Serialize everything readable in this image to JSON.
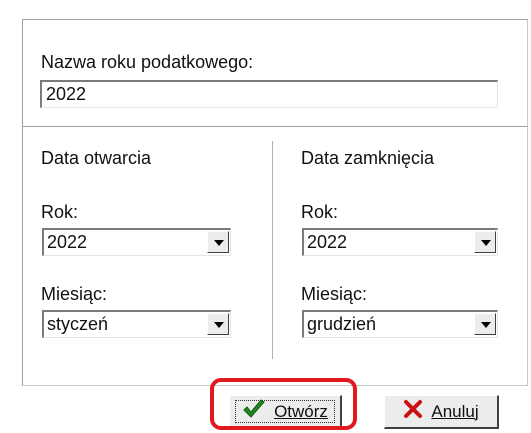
{
  "tax_year": {
    "name_label": "Nazwa roku podatkowego:",
    "name_value": "2022"
  },
  "opening": {
    "title": "Data otwarcia",
    "year_label": "Rok:",
    "year_value": "2022",
    "month_label": "Miesiąc:",
    "month_value": "styczeń"
  },
  "closing": {
    "title": "Data zamknięcia",
    "year_label": "Rok:",
    "year_value": "2022",
    "month_label": "Miesiąc:",
    "month_value": "grudzień"
  },
  "buttons": {
    "ok_label": "Otwórz",
    "cancel_label": "Anuluj"
  },
  "colors": {
    "highlight": "#e2191e",
    "check_icon": "#1e8a1e"
  },
  "icons": {
    "ok": "check-icon",
    "cancel": "cross-icon"
  }
}
